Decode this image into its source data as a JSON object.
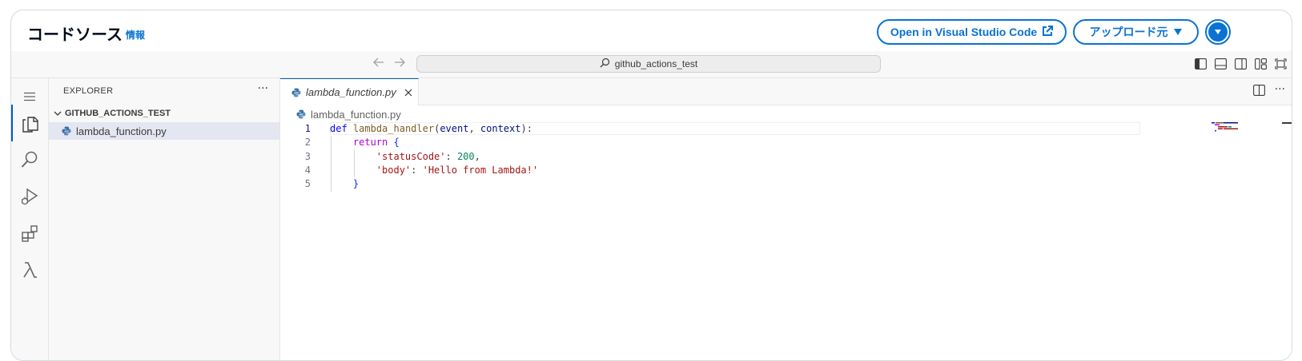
{
  "header": {
    "title": "コードソース",
    "info_link": "情報",
    "vscode_button": "Open in Visual Studio Code",
    "upload_button": "アップロード元",
    "accent_color": "#0972d3"
  },
  "titlebar": {
    "search_text": "github_actions_test"
  },
  "activity_bar": {
    "items": [
      "menu-icon",
      "files-icon",
      "search-icon",
      "run-debug-icon",
      "extensions-icon",
      "lambda-icon"
    ]
  },
  "explorer": {
    "title": "EXPLORER",
    "folder": "GITHUB_ACTIONS_TEST",
    "file": "lambda_function.py"
  },
  "editor": {
    "tab_label": "lambda_function.py",
    "breadcrumb": "lambda_function.py",
    "line_numbers": [
      "1",
      "2",
      "3",
      "4",
      "5"
    ],
    "code": {
      "l1_def": "def",
      "l1_fn": "lambda_handler",
      "l1_open": "(",
      "l1_p1": "event",
      "l1_comma": ", ",
      "l1_p2": "context",
      "l1_close": "):",
      "l2_return": "return",
      "l2_brace": "{",
      "l3_key": "'statusCode'",
      "l3_colon": ": ",
      "l3_val": "200",
      "l3_comma": ",",
      "l4_key": "'body'",
      "l4_colon": ": ",
      "l4_val": "'Hello from Lambda!'",
      "l5_brace": "}"
    }
  }
}
